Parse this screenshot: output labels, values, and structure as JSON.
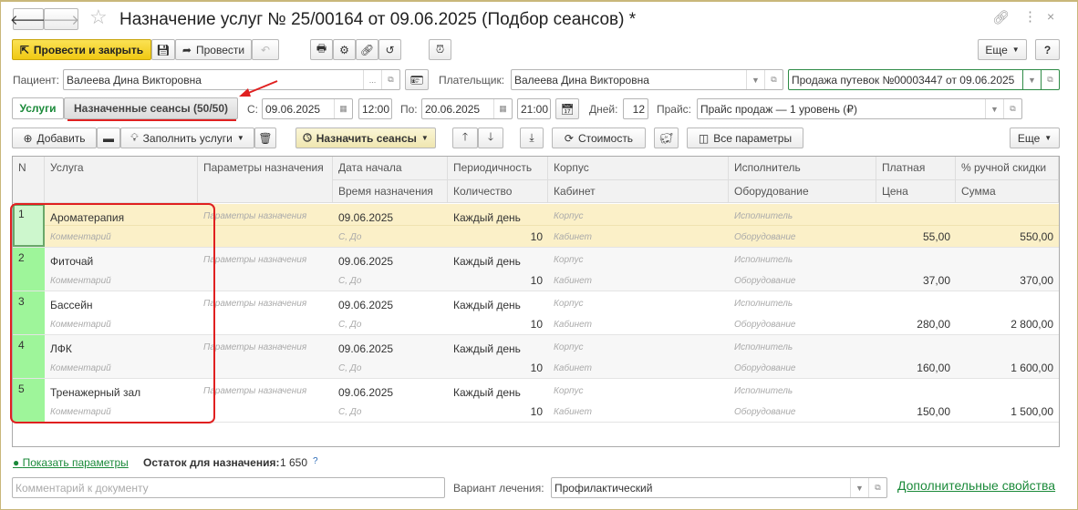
{
  "window": {
    "title": "Назначение услуг № 25/00164 от 09.06.2025 (Подбор сеансов) *"
  },
  "toolbar": {
    "post_close": "Провести и закрыть",
    "post": "Провести",
    "more": "Еще",
    "help": "?"
  },
  "form": {
    "patient_label": "Пациент:",
    "patient": "Валеева Дина Викторовна",
    "patient_dots": "...",
    "payer_label": "Плательщик:",
    "payer": "Валеева Дина Викторовна",
    "sale_doc": "Продажа путевок №00003447 от 09.06.2025",
    "tab_services": "Услуги",
    "tab_sessions": "Назначенные сеансы (50/50)",
    "from_label": "С:",
    "from_date": "09.06.2025",
    "from_time": "12:00",
    "to_label": "По:",
    "to_date": "20.06.2025",
    "to_time": "21:00",
    "days_label": "Дней:",
    "days": "12",
    "price_label": "Прайс:",
    "price": "Прайс продаж — 1 уровень (₽)"
  },
  "tabletoolbar": {
    "add": "Добавить",
    "fill": "Заполнить услуги",
    "assign": "Назначить сеансы",
    "cost": "Стоимость",
    "all_params": "Все параметры",
    "more": "Еще"
  },
  "table": {
    "headers": {
      "n": "N",
      "service": "Услуга",
      "params": "Параметры назначения",
      "date": "Дата начала",
      "time": "Время назначения",
      "period": "Периодичность",
      "qty": "Количество",
      "building": "Корпус",
      "room": "Кабинет",
      "executor": "Исполнитель",
      "equipment": "Оборудование",
      "paid": "Платная",
      "price": "Цена",
      "discount": "% ручной скидки",
      "sum": "Сумма"
    },
    "placeholders": {
      "params": "Параметры назначения",
      "comment": "Комментарий",
      "time": "С, До",
      "building": "Корпус",
      "room": "Кабинет",
      "executor": "Исполнитель",
      "equipment": "Оборудование"
    },
    "rows": [
      {
        "n": "1",
        "service": "Ароматерапия",
        "date": "09.06.2025",
        "period": "Каждый день",
        "qty": "10",
        "price": "55,00",
        "sum": "550,00"
      },
      {
        "n": "2",
        "service": "Фиточай",
        "date": "09.06.2025",
        "period": "Каждый день",
        "qty": "10",
        "price": "37,00",
        "sum": "370,00"
      },
      {
        "n": "3",
        "service": "Бассейн",
        "date": "09.06.2025",
        "period": "Каждый день",
        "qty": "10",
        "price": "280,00",
        "sum": "2 800,00"
      },
      {
        "n": "4",
        "service": "ЛФК",
        "date": "09.06.2025",
        "period": "Каждый день",
        "qty": "10",
        "price": "160,00",
        "sum": "1 600,00"
      },
      {
        "n": "5",
        "service": "Тренажерный зал",
        "date": "09.06.2025",
        "period": "Каждый день",
        "qty": "10",
        "price": "150,00",
        "sum": "1 500,00"
      }
    ]
  },
  "footer": {
    "show_params": "Показать параметры",
    "remainder_label": "Остаток для назначения:",
    "remainder": "1 650",
    "hint": "?",
    "comment_placeholder": "Комментарий к документу",
    "variant_label": "Вариант лечения:",
    "variant": "Профилактический",
    "extra": "Дополнительные свойства"
  },
  "colors": {
    "accent": "#f3d11e",
    "green": "#1b8a3a",
    "selected": "#fbf0c8",
    "highlight": "#e02020"
  }
}
